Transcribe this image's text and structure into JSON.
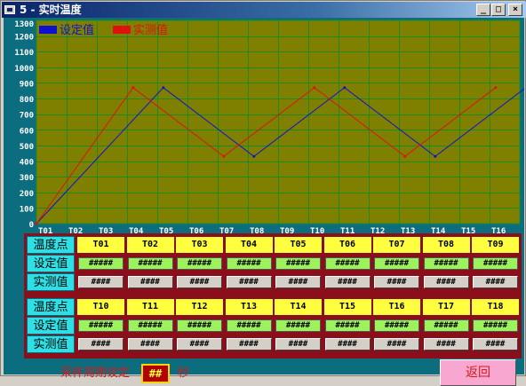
{
  "window": {
    "title": "5 - 实时温度",
    "controls": {
      "minimize": "_",
      "maximize": "□",
      "close": "×"
    }
  },
  "legend": {
    "set_label": "设定值",
    "actual_label": "实测值"
  },
  "colors": {
    "plot_bg": "#808000",
    "grid": "#1f8a1f",
    "set_series": "#1010d0",
    "actual_series": "#e01010",
    "axis_text": "#ffffff",
    "client_bg": "#0b6d7e",
    "table_border": "#8b0f1a",
    "header_cell": "#ffff40",
    "set_cell": "#9bf25b",
    "row_label": "#2ce0e6",
    "back_button": "#f8a8d0"
  },
  "chart_data": {
    "type": "line",
    "title": "",
    "xlabel": "",
    "ylabel": "",
    "ylim": [
      0,
      1300
    ],
    "y_ticks": [
      "1300",
      "1200",
      "1100",
      "1000",
      "900",
      "800",
      "700",
      "600",
      "500",
      "400",
      "300",
      "200",
      "100",
      "0"
    ],
    "x_ticks": [
      "T01",
      "T02",
      "T03",
      "T04",
      "T05",
      "T06",
      "T07",
      "T08",
      "T09",
      "T10",
      "T11",
      "T12",
      "T13",
      "T14",
      "T15",
      "T16"
    ],
    "grid": true,
    "legend_position": "top-left",
    "series": [
      {
        "name": "设定值",
        "color": "#1010d0",
        "points": [
          [
            0,
            0
          ],
          [
            4.2,
            870
          ],
          [
            7.2,
            430
          ],
          [
            10.2,
            870
          ],
          [
            13.2,
            430
          ],
          [
            16.2,
            870
          ]
        ]
      },
      {
        "name": "实测值",
        "color": "#e01010",
        "points": [
          [
            0,
            0
          ],
          [
            3.2,
            870
          ],
          [
            6.2,
            430
          ],
          [
            9.2,
            870
          ],
          [
            12.2,
            430
          ],
          [
            15.2,
            870
          ]
        ]
      }
    ]
  },
  "table": {
    "row_labels": {
      "point": "温度点",
      "set": "设定值",
      "actual": "实测值"
    },
    "groups": [
      {
        "points": [
          "T01",
          "T02",
          "T03",
          "T04",
          "T05",
          "T06",
          "T07",
          "T08",
          "T09"
        ],
        "set_values": [
          "#####",
          "#####",
          "#####",
          "#####",
          "#####",
          "#####",
          "#####",
          "#####",
          "#####"
        ],
        "actual_values": [
          "####",
          "####",
          "####",
          "####",
          "####",
          "####",
          "####",
          "####",
          "####"
        ]
      },
      {
        "points": [
          "T10",
          "T11",
          "T12",
          "T13",
          "T14",
          "T15",
          "T16",
          "T17",
          "T18"
        ],
        "set_values": [
          "#####",
          "#####",
          "#####",
          "#####",
          "#####",
          "#####",
          "#####",
          "#####",
          "#####"
        ],
        "actual_values": [
          "####",
          "####",
          "####",
          "####",
          "####",
          "####",
          "####",
          "####",
          "####"
        ]
      }
    ]
  },
  "footer": {
    "sampling_label": "采样周期设定",
    "sampling_value": "##",
    "sampling_unit": "秒",
    "back_label": "返回"
  }
}
